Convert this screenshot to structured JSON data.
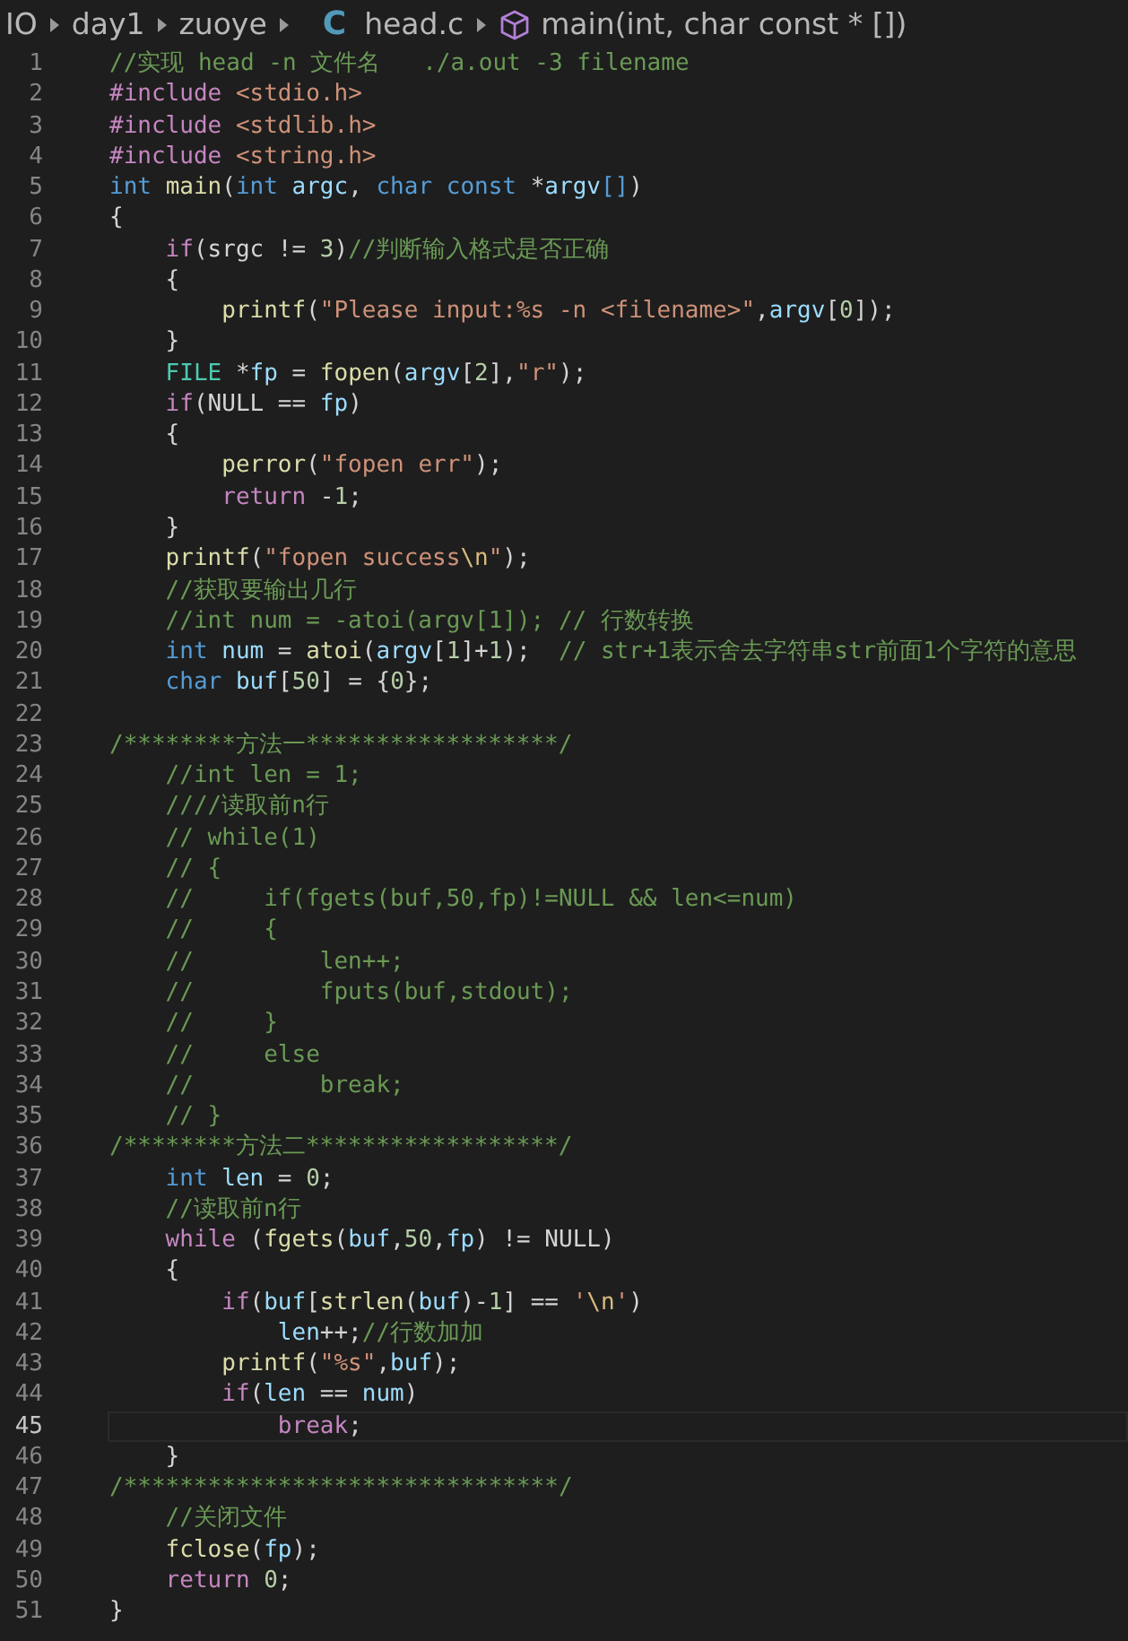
{
  "breadcrumb": [
    {
      "label": "IO",
      "kind": "folder"
    },
    {
      "label": "day1",
      "kind": "folder"
    },
    {
      "label": "zuoye",
      "kind": "folder"
    },
    {
      "label": "head.c",
      "kind": "file",
      "icon_text": "C"
    },
    {
      "label": "main(int, char const * [])",
      "kind": "symbol"
    }
  ],
  "editor": {
    "lines": [
      {
        "number": "1",
        "current": false,
        "tokens": [
          {
            "kind": "comment",
            "text": "//实现 head -n 文件名   ./a.out -3 filename"
          }
        ]
      },
      {
        "number": "2",
        "current": false,
        "tokens": [
          {
            "kind": "keyword",
            "text": "#include "
          },
          {
            "kind": "string",
            "text": "<stdio.h>"
          }
        ]
      },
      {
        "number": "3",
        "current": false,
        "tokens": [
          {
            "kind": "keyword",
            "text": "#include "
          },
          {
            "kind": "string",
            "text": "<stdlib.h>"
          }
        ]
      },
      {
        "number": "4",
        "current": false,
        "tokens": [
          {
            "kind": "keyword",
            "text": "#include "
          },
          {
            "kind": "string",
            "text": "<string.h>"
          }
        ]
      },
      {
        "number": "5",
        "current": false,
        "tokens": [
          {
            "kind": "type",
            "text": "int "
          },
          {
            "kind": "function",
            "text": "main"
          },
          {
            "kind": "plain",
            "text": "("
          },
          {
            "kind": "type",
            "text": "int "
          },
          {
            "kind": "variable",
            "text": "argc"
          },
          {
            "kind": "plain",
            "text": ", "
          },
          {
            "kind": "type",
            "text": "char "
          },
          {
            "kind": "type",
            "text": "const "
          },
          {
            "kind": "plain",
            "text": "*"
          },
          {
            "kind": "variable",
            "text": "argv"
          },
          {
            "kind": "type",
            "text": "[]"
          },
          {
            "kind": "plain",
            "text": ")"
          }
        ]
      },
      {
        "number": "6",
        "current": false,
        "tokens": [
          {
            "kind": "plain",
            "text": "{"
          }
        ]
      },
      {
        "number": "7",
        "current": false,
        "tokens": [
          {
            "kind": "keyword",
            "text": "    if"
          },
          {
            "kind": "plain",
            "text": "(srgc != "
          },
          {
            "kind": "number",
            "text": "3"
          },
          {
            "kind": "plain",
            "text": ")"
          },
          {
            "kind": "comment",
            "text": "//判断输入格式是否正确"
          }
        ]
      },
      {
        "number": "8",
        "current": false,
        "tokens": [
          {
            "kind": "plain",
            "text": "    {"
          }
        ]
      },
      {
        "number": "9",
        "current": false,
        "tokens": [
          {
            "kind": "function",
            "text": "        printf"
          },
          {
            "kind": "plain",
            "text": "("
          },
          {
            "kind": "string",
            "text": "\"Please input:%s -n <filename>\""
          },
          {
            "kind": "plain",
            "text": ","
          },
          {
            "kind": "variable",
            "text": "argv"
          },
          {
            "kind": "plain",
            "text": "["
          },
          {
            "kind": "number",
            "text": "0"
          },
          {
            "kind": "plain",
            "text": "]);"
          }
        ]
      },
      {
        "number": "10",
        "current": false,
        "tokens": [
          {
            "kind": "plain",
            "text": "    }"
          }
        ]
      },
      {
        "number": "11",
        "current": false,
        "tokens": [
          {
            "kind": "typename",
            "text": "    FILE"
          },
          {
            "kind": "plain",
            "text": " *"
          },
          {
            "kind": "variable",
            "text": "fp"
          },
          {
            "kind": "plain",
            "text": " = "
          },
          {
            "kind": "function",
            "text": "fopen"
          },
          {
            "kind": "plain",
            "text": "("
          },
          {
            "kind": "variable",
            "text": "argv"
          },
          {
            "kind": "plain",
            "text": "["
          },
          {
            "kind": "number",
            "text": "2"
          },
          {
            "kind": "plain",
            "text": "],"
          },
          {
            "kind": "string",
            "text": "\"r\""
          },
          {
            "kind": "plain",
            "text": ");"
          }
        ]
      },
      {
        "number": "12",
        "current": false,
        "tokens": [
          {
            "kind": "keyword",
            "text": "    if"
          },
          {
            "kind": "plain",
            "text": "(NULL == "
          },
          {
            "kind": "variable",
            "text": "fp"
          },
          {
            "kind": "plain",
            "text": ")"
          }
        ]
      },
      {
        "number": "13",
        "current": false,
        "tokens": [
          {
            "kind": "plain",
            "text": "    {"
          }
        ]
      },
      {
        "number": "14",
        "current": false,
        "tokens": [
          {
            "kind": "function",
            "text": "        perror"
          },
          {
            "kind": "plain",
            "text": "("
          },
          {
            "kind": "string",
            "text": "\"fopen err\""
          },
          {
            "kind": "plain",
            "text": ");"
          }
        ]
      },
      {
        "number": "15",
        "current": false,
        "tokens": [
          {
            "kind": "keyword",
            "text": "        return"
          },
          {
            "kind": "plain",
            "text": " -"
          },
          {
            "kind": "number",
            "text": "1"
          },
          {
            "kind": "plain",
            "text": ";"
          }
        ]
      },
      {
        "number": "16",
        "current": false,
        "tokens": [
          {
            "kind": "plain",
            "text": "    }"
          }
        ]
      },
      {
        "number": "17",
        "current": false,
        "tokens": [
          {
            "kind": "function",
            "text": "    printf"
          },
          {
            "kind": "plain",
            "text": "("
          },
          {
            "kind": "string",
            "text": "\"fopen success"
          },
          {
            "kind": "escape",
            "text": "\\n"
          },
          {
            "kind": "string",
            "text": "\""
          },
          {
            "kind": "plain",
            "text": ");"
          }
        ]
      },
      {
        "number": "18",
        "current": false,
        "tokens": [
          {
            "kind": "comment",
            "text": "    //获取要输出几行"
          }
        ]
      },
      {
        "number": "19",
        "current": false,
        "tokens": [
          {
            "kind": "comment",
            "text": "    //int num = -atoi(argv[1]); // 行数转换"
          }
        ]
      },
      {
        "number": "20",
        "current": false,
        "tokens": [
          {
            "kind": "type",
            "text": "    int "
          },
          {
            "kind": "variable",
            "text": "num"
          },
          {
            "kind": "plain",
            "text": " = "
          },
          {
            "kind": "function",
            "text": "atoi"
          },
          {
            "kind": "plain",
            "text": "("
          },
          {
            "kind": "variable",
            "text": "argv"
          },
          {
            "kind": "plain",
            "text": "["
          },
          {
            "kind": "number",
            "text": "1"
          },
          {
            "kind": "plain",
            "text": "]+"
          },
          {
            "kind": "number",
            "text": "1"
          },
          {
            "kind": "plain",
            "text": ");  "
          },
          {
            "kind": "comment",
            "text": "// str+1表示舍去字符串str前面1个字符的意思"
          }
        ]
      },
      {
        "number": "21",
        "current": false,
        "tokens": [
          {
            "kind": "type",
            "text": "    char "
          },
          {
            "kind": "variable",
            "text": "buf"
          },
          {
            "kind": "plain",
            "text": "["
          },
          {
            "kind": "number",
            "text": "50"
          },
          {
            "kind": "plain",
            "text": "] = {"
          },
          {
            "kind": "number",
            "text": "0"
          },
          {
            "kind": "plain",
            "text": "};"
          }
        ]
      },
      {
        "number": "22",
        "current": false
      },
      {
        "number": "23",
        "current": false,
        "tokens": [
          {
            "kind": "comment",
            "text": "/********方法一******************/"
          }
        ]
      },
      {
        "number": "24",
        "current": false,
        "tokens": [
          {
            "kind": "comment",
            "text": "    //int len = 1;"
          }
        ]
      },
      {
        "number": "25",
        "current": false,
        "tokens": [
          {
            "kind": "comment",
            "text": "    ////读取前n行"
          }
        ]
      },
      {
        "number": "26",
        "current": false,
        "tokens": [
          {
            "kind": "comment",
            "text": "    // while(1)"
          }
        ]
      },
      {
        "number": "27",
        "current": false,
        "tokens": [
          {
            "kind": "comment",
            "text": "    // {"
          }
        ]
      },
      {
        "number": "28",
        "current": false,
        "tokens": [
          {
            "kind": "comment",
            "text": "    //     if(fgets(buf,50,fp)!=NULL && len<=num)"
          }
        ]
      },
      {
        "number": "29",
        "current": false,
        "tokens": [
          {
            "kind": "comment",
            "text": "    //     {"
          }
        ]
      },
      {
        "number": "30",
        "current": false,
        "tokens": [
          {
            "kind": "comment",
            "text": "    //         len++;"
          }
        ]
      },
      {
        "number": "31",
        "current": false,
        "tokens": [
          {
            "kind": "comment",
            "text": "    //         fputs(buf,stdout);"
          }
        ]
      },
      {
        "number": "32",
        "current": false,
        "tokens": [
          {
            "kind": "comment",
            "text": "    //     }"
          }
        ]
      },
      {
        "number": "33",
        "current": false,
        "tokens": [
          {
            "kind": "comment",
            "text": "    //     else"
          }
        ]
      },
      {
        "number": "34",
        "current": false,
        "tokens": [
          {
            "kind": "comment",
            "text": "    //         break;"
          }
        ]
      },
      {
        "number": "35",
        "current": false,
        "tokens": [
          {
            "kind": "comment",
            "text": "    // }"
          }
        ]
      },
      {
        "number": "36",
        "current": false,
        "tokens": [
          {
            "kind": "comment",
            "text": "/********方法二******************/"
          }
        ]
      },
      {
        "number": "37",
        "current": false,
        "tokens": [
          {
            "kind": "type",
            "text": "    int "
          },
          {
            "kind": "variable",
            "text": "len"
          },
          {
            "kind": "plain",
            "text": " = "
          },
          {
            "kind": "number",
            "text": "0"
          },
          {
            "kind": "plain",
            "text": ";"
          }
        ]
      },
      {
        "number": "38",
        "current": false,
        "tokens": [
          {
            "kind": "comment",
            "text": "    //读取前n行"
          }
        ]
      },
      {
        "number": "39",
        "current": false,
        "tokens": [
          {
            "kind": "keyword",
            "text": "    while"
          },
          {
            "kind": "plain",
            "text": " ("
          },
          {
            "kind": "function",
            "text": "fgets"
          },
          {
            "kind": "plain",
            "text": "("
          },
          {
            "kind": "variable",
            "text": "buf"
          },
          {
            "kind": "plain",
            "text": ","
          },
          {
            "kind": "number",
            "text": "50"
          },
          {
            "kind": "plain",
            "text": ","
          },
          {
            "kind": "variable",
            "text": "fp"
          },
          {
            "kind": "plain",
            "text": ") != NULL)"
          }
        ]
      },
      {
        "number": "40",
        "current": false,
        "tokens": [
          {
            "kind": "plain",
            "text": "    {"
          }
        ]
      },
      {
        "number": "41",
        "current": false,
        "tokens": [
          {
            "kind": "keyword",
            "text": "        if"
          },
          {
            "kind": "plain",
            "text": "("
          },
          {
            "kind": "variable",
            "text": "buf"
          },
          {
            "kind": "plain",
            "text": "["
          },
          {
            "kind": "function",
            "text": "strlen"
          },
          {
            "kind": "plain",
            "text": "("
          },
          {
            "kind": "variable",
            "text": "buf"
          },
          {
            "kind": "plain",
            "text": ")-"
          },
          {
            "kind": "number",
            "text": "1"
          },
          {
            "kind": "plain",
            "text": "] == "
          },
          {
            "kind": "string",
            "text": "'"
          },
          {
            "kind": "escape",
            "text": "\\n"
          },
          {
            "kind": "string",
            "text": "'"
          },
          {
            "kind": "plain",
            "text": ")"
          }
        ]
      },
      {
        "number": "42",
        "current": false,
        "tokens": [
          {
            "kind": "variable",
            "text": "            len"
          },
          {
            "kind": "plain",
            "text": "++;"
          },
          {
            "kind": "comment",
            "text": "//行数加加"
          }
        ]
      },
      {
        "number": "43",
        "current": false,
        "tokens": [
          {
            "kind": "function",
            "text": "        printf"
          },
          {
            "kind": "plain",
            "text": "("
          },
          {
            "kind": "string",
            "text": "\"%s\""
          },
          {
            "kind": "plain",
            "text": ","
          },
          {
            "kind": "variable",
            "text": "buf"
          },
          {
            "kind": "plain",
            "text": ");"
          }
        ]
      },
      {
        "number": "44",
        "current": false,
        "tokens": [
          {
            "kind": "keyword",
            "text": "        if"
          },
          {
            "kind": "plain",
            "text": "("
          },
          {
            "kind": "variable",
            "text": "len"
          },
          {
            "kind": "plain",
            "text": " == "
          },
          {
            "kind": "variable",
            "text": "num"
          },
          {
            "kind": "plain",
            "text": ")"
          }
        ]
      },
      {
        "number": "45",
        "current": true,
        "tokens": [
          {
            "kind": "keyword",
            "text": "            break"
          },
          {
            "kind": "plain",
            "text": ";"
          }
        ]
      },
      {
        "number": "46",
        "current": false,
        "tokens": [
          {
            "kind": "plain",
            "text": "    }"
          }
        ]
      },
      {
        "number": "47",
        "current": false,
        "tokens": [
          {
            "kind": "comment",
            "text": "/*******************************/"
          }
        ]
      },
      {
        "number": "48",
        "current": false,
        "tokens": [
          {
            "kind": "comment",
            "text": "    //关闭文件"
          }
        ]
      },
      {
        "number": "49",
        "current": false,
        "tokens": [
          {
            "kind": "function",
            "text": "    fclose"
          },
          {
            "kind": "plain",
            "text": "("
          },
          {
            "kind": "variable",
            "text": "fp"
          },
          {
            "kind": "plain",
            "text": ");"
          }
        ]
      },
      {
        "number": "50",
        "current": false,
        "tokens": [
          {
            "kind": "keyword",
            "text": "    return "
          },
          {
            "kind": "number",
            "text": "0"
          },
          {
            "kind": "plain",
            "text": ";"
          }
        ]
      },
      {
        "number": "51",
        "current": false,
        "tokens": [
          {
            "kind": "plain",
            "text": "}"
          }
        ]
      }
    ]
  }
}
